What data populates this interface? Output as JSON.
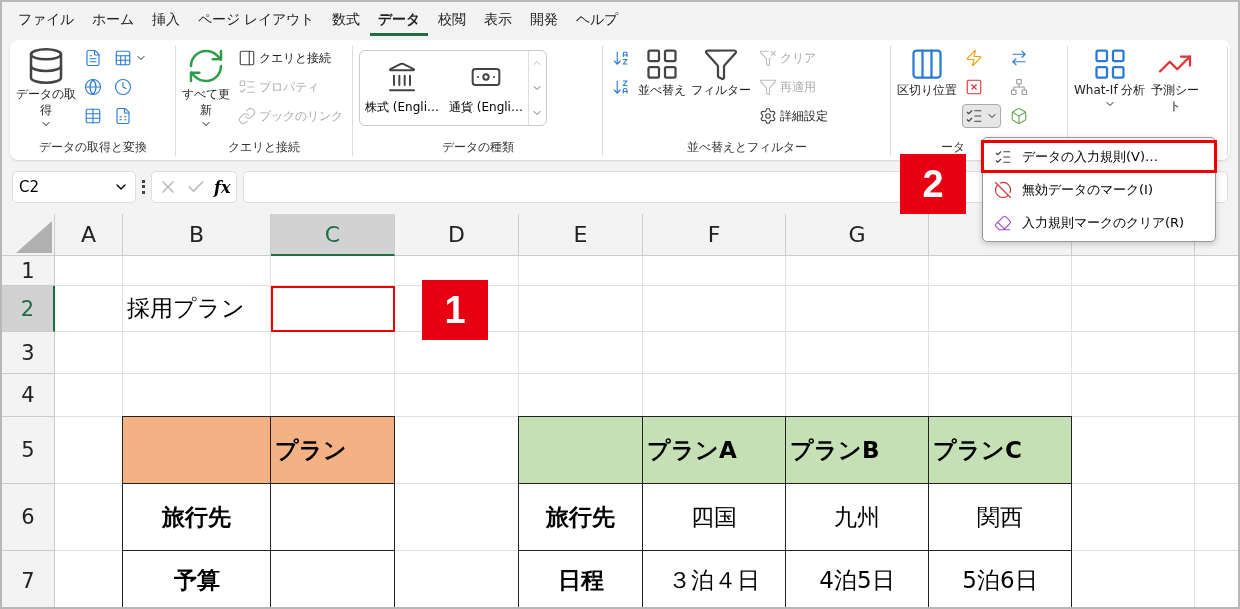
{
  "tabs": [
    {
      "label": "ファイル",
      "selected": false
    },
    {
      "label": "ホーム",
      "selected": false
    },
    {
      "label": "挿入",
      "selected": false
    },
    {
      "label": "ページ レイアウト",
      "selected": false
    },
    {
      "label": "数式",
      "selected": false
    },
    {
      "label": "データ",
      "selected": true
    },
    {
      "label": "校閲",
      "selected": false
    },
    {
      "label": "表示",
      "selected": false
    },
    {
      "label": "開発",
      "selected": false
    },
    {
      "label": "ヘルプ",
      "selected": false
    }
  ],
  "ribbon": {
    "groups": [
      {
        "label": "データの取得と変換",
        "large": [
          {
            "label": "データの取得",
            "dropdown": true
          }
        ],
        "small": [
          {
            "disabled": false
          },
          {
            "disabled": false,
            "dropdown": true
          },
          {
            "disabled": false
          },
          {
            "disabled": false
          },
          {
            "disabled": false
          },
          {
            "disabled": false
          }
        ]
      },
      {
        "label": "クエリと接続",
        "large": [
          {
            "label": "すべて更新",
            "dropdown": true
          }
        ],
        "small": [
          {
            "label": "クエリと接続",
            "disabled": false
          },
          {
            "label": "プロパティ",
            "disabled": true
          },
          {
            "label": "ブックのリンク",
            "disabled": true
          }
        ]
      },
      {
        "label": "データの種類",
        "gallery": [
          "株式 (Engli…",
          "通貨 (Engli…"
        ]
      },
      {
        "label": "並べ替えとフィルター",
        "large": [
          {
            "label": "並べ替え",
            "dropdown": false
          },
          {
            "label": "フィルター",
            "dropdown": false
          }
        ],
        "small": [
          {
            "label": "クリア",
            "disabled": true
          },
          {
            "label": "再適用",
            "disabled": true
          },
          {
            "label": "詳細設定",
            "disabled": false
          }
        ]
      },
      {
        "label": "ータ",
        "large": [
          {
            "label": "区切り位置",
            "dropdown": false
          }
        ],
        "small": [
          {
            "pressed": false
          },
          {
            "pressed": false
          },
          {
            "pressed": false
          },
          {
            "pressed": false
          },
          {
            "pressed": true,
            "dropdown": true
          },
          {
            "pressed": false
          }
        ]
      },
      {
        "large": [
          {
            "label": "What-If 分析",
            "dropdown": true
          },
          {
            "label": "予測シート",
            "dropdown": false
          }
        ]
      }
    ]
  },
  "formula_bar": {
    "name_box": "C2",
    "fx": "fx"
  },
  "sheet": {
    "columns": [
      {
        "label": "A",
        "selected": false
      },
      {
        "label": "B",
        "selected": false
      },
      {
        "label": "C",
        "selected": true
      },
      {
        "label": "D",
        "selected": false
      },
      {
        "label": "E",
        "selected": false
      },
      {
        "label": "F",
        "selected": false
      },
      {
        "label": "G",
        "selected": false
      }
    ],
    "rows": [
      {
        "number": "1",
        "selected": false,
        "cells": []
      },
      {
        "number": "2",
        "selected": true,
        "cells": [
          {
            "kind": "empty"
          },
          {
            "kind": "text",
            "text": "採用プラン"
          },
          {
            "kind": "active",
            "selected": true
          }
        ]
      },
      {
        "number": "3",
        "selected": false,
        "cells": []
      },
      {
        "number": "4",
        "selected": false,
        "cells": []
      },
      {
        "number": "5",
        "selected": false,
        "cells": [
          {
            "kind": "empty"
          },
          {
            "kind": "header",
            "color": "#f4b183"
          },
          {
            "kind": "header",
            "color": "#f4b183",
            "text": "プラン"
          },
          {
            "kind": "empty"
          },
          {
            "kind": "header",
            "color": "#c5e0b4"
          },
          {
            "kind": "header",
            "color": "#c5e0b4",
            "text": "プランA"
          },
          {
            "kind": "header",
            "color": "#c5e0b4",
            "text": "プランB"
          },
          {
            "kind": "header",
            "color": "#c5e0b4",
            "text": "プランC"
          }
        ]
      },
      {
        "number": "6",
        "selected": false,
        "cells": [
          {
            "kind": "empty"
          },
          {
            "kind": "label",
            "text": "旅行先"
          },
          {
            "kind": "value"
          },
          {
            "kind": "empty"
          },
          {
            "kind": "label",
            "text": "旅行先"
          },
          {
            "kind": "value",
            "text": "四国"
          },
          {
            "kind": "value",
            "text": "九州"
          },
          {
            "kind": "value",
            "text": "関西"
          }
        ]
      },
      {
        "number": "7",
        "selected": false,
        "cells": [
          {
            "kind": "empty"
          },
          {
            "kind": "label",
            "text": "予算"
          },
          {
            "kind": "value"
          },
          {
            "kind": "empty"
          },
          {
            "kind": "label",
            "text": "日程"
          },
          {
            "kind": "value",
            "text": "３泊４日"
          },
          {
            "kind": "value",
            "text": "4泊5日"
          },
          {
            "kind": "value",
            "text": "5泊6日"
          }
        ]
      }
    ]
  },
  "menu": [
    {
      "label": "データの入力規則(V)…",
      "highlighted": true
    },
    {
      "label": "無効データのマーク(I)",
      "highlighted": false
    },
    {
      "label": "入力規則マークのクリア(R)",
      "highlighted": false
    }
  ],
  "callouts": [
    "1",
    "2"
  ]
}
